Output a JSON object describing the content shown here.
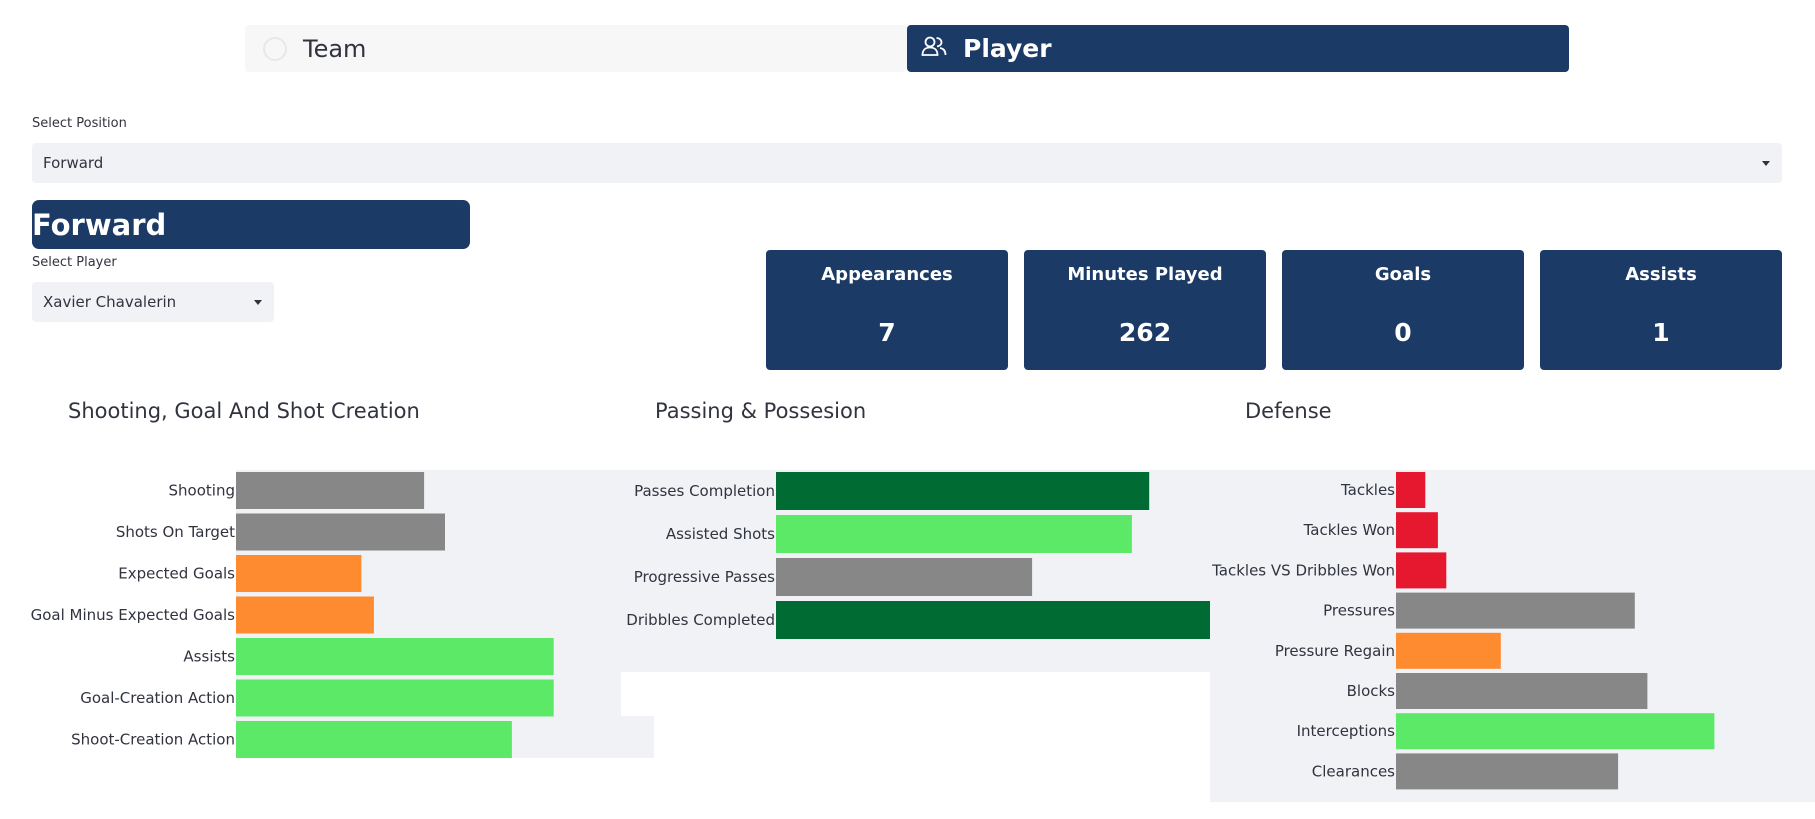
{
  "tabs": {
    "team_label": "Team",
    "player_label": "Player",
    "team_icon": "circle-icon",
    "player_icon": "users-icon"
  },
  "position": {
    "label": "Select Position",
    "value": "Forward"
  },
  "banner": "Forward",
  "player": {
    "label": "Select Player",
    "value": "Xavier Chavalerin"
  },
  "stats": [
    {
      "title": "Appearances",
      "value": "7"
    },
    {
      "title": "Minutes Played",
      "value": "262"
    },
    {
      "title": "Goals",
      "value": "0"
    },
    {
      "title": "Assists",
      "value": "1"
    }
  ],
  "colors": {
    "navy": "#1c3a66",
    "grey": "#878787",
    "orange": "#fe8b2f",
    "light_green": "#5ce968",
    "dark_green": "#006c33",
    "red": "#e6182f",
    "plot_bg": "#f0f2f6"
  },
  "chart_data": [
    {
      "type": "bar",
      "orientation": "horizontal",
      "title": "Shooting, Goal And Shot Creation",
      "categories": [
        "Shooting",
        "Shots On Target",
        "Expected Goals",
        "Goal Minus Expected Goals",
        "Assists",
        "Goal-Creation Action",
        "Shoot-Creation Action"
      ],
      "values": [
        45,
        50,
        30,
        33,
        76,
        76,
        66
      ],
      "bar_colors": [
        "#878787",
        "#878787",
        "#fe8b2f",
        "#fe8b2f",
        "#5ce968",
        "#5ce968",
        "#5ce968"
      ],
      "xlim": [
        0,
        100
      ]
    },
    {
      "type": "bar",
      "orientation": "horizontal",
      "title": "Passing & Possesion",
      "categories": [
        "Passes Completion",
        "Assisted Shots",
        "Progressive Passes",
        "Dribbles Completed"
      ],
      "values": [
        86,
        82,
        59,
        100
      ],
      "bar_colors": [
        "#006c33",
        "#5ce968",
        "#878787",
        "#006c33"
      ],
      "xlim": [
        0,
        100
      ]
    },
    {
      "type": "bar",
      "orientation": "horizontal",
      "title": "Defense",
      "categories": [
        "Tackles",
        "Tackles Won",
        "Tackles VS Dribbles Won",
        "Pressures",
        "Pressure Regain",
        "Blocks",
        "Interceptions",
        "Clearances"
      ],
      "values": [
        7,
        10,
        12,
        57,
        25,
        60,
        76,
        53
      ],
      "bar_colors": [
        "#e6182f",
        "#e6182f",
        "#e6182f",
        "#878787",
        "#fe8b2f",
        "#878787",
        "#5ce968",
        "#878787"
      ],
      "xlim": [
        0,
        100
      ]
    }
  ]
}
